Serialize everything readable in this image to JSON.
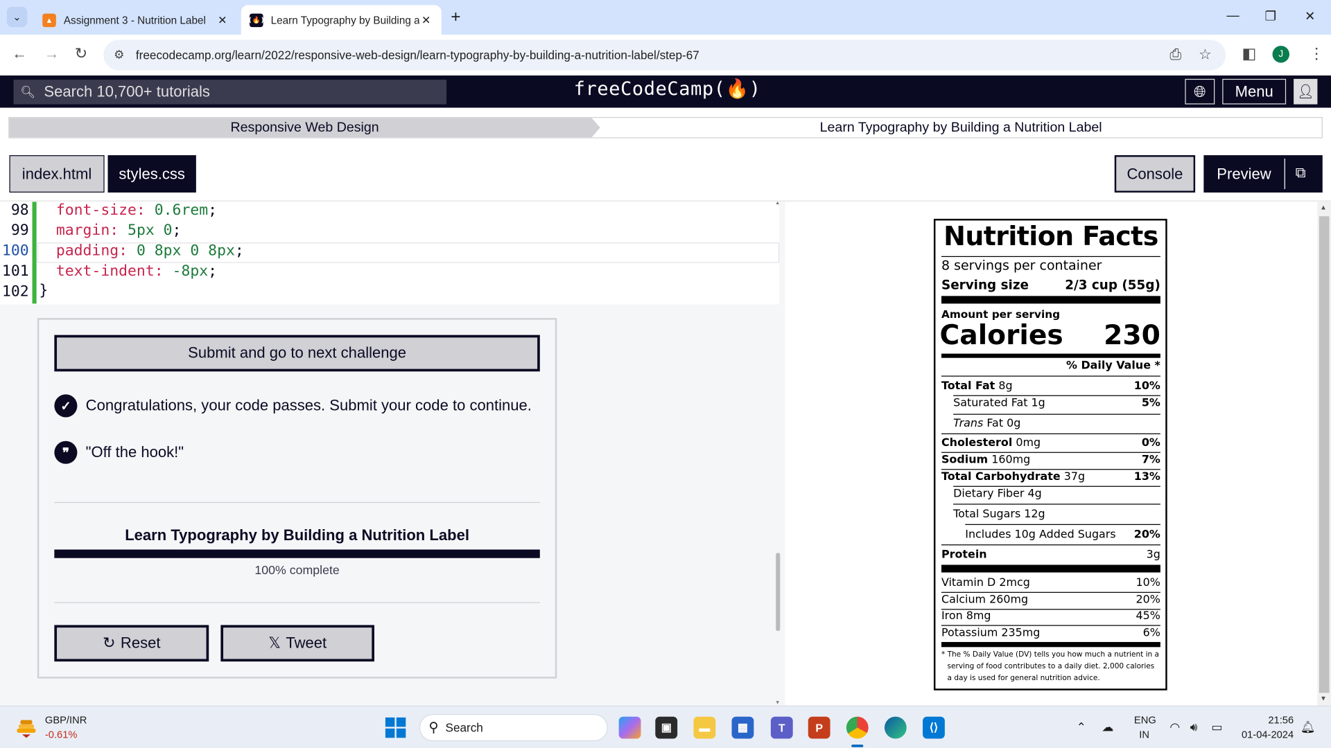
{
  "browser": {
    "tabs": [
      {
        "title": "Assignment 3 - Nutrition Label",
        "active": false
      },
      {
        "title": "Learn Typography by Building a Nutrition Label",
        "active": true
      }
    ],
    "url": "freecodecamp.org/learn/2022/responsive-web-design/learn-typography-by-building-a-nutrition-label/step-67",
    "profile_initial": "J"
  },
  "fcc_nav": {
    "search_placeholder": "Search 10,700+ tutorials",
    "logo": "freeCodeCamp(🔥)",
    "menu_label": "Menu"
  },
  "breadcrumb": {
    "superblock": "Responsive Web Design",
    "block": "Learn Typography by Building a Nutrition Label"
  },
  "editor_tabs": {
    "html": "index.html",
    "css": "styles.css",
    "console": "Console",
    "preview": "Preview"
  },
  "code_lines": [
    {
      "num": "98",
      "prop": "font-size",
      "val": "0.6rem"
    },
    {
      "num": "99",
      "prop": "margin",
      "val": "5px 0"
    },
    {
      "num": "100",
      "prop": "padding",
      "val": "0 8px 0 8px"
    },
    {
      "num": "101",
      "prop": "text-indent",
      "val": "-8px"
    },
    {
      "num": "102",
      "brace": "}"
    }
  ],
  "challenge": {
    "submit_label": "Submit and go to next challenge",
    "pass_message": "Congratulations, your code passes. Submit your code to continue.",
    "quote": "\"Off the hook!\"",
    "course_title": "Learn Typography by Building a Nutrition Label",
    "progress_fraction": 1.0,
    "progress_text": "100% complete",
    "reset_label": "Reset",
    "tweet_label": "Tweet"
  },
  "nutrition": {
    "title": "Nutrition Facts",
    "servings": "8 servings per container",
    "serving_size_label": "Serving size",
    "serving_size_value": "2/3 cup (55g)",
    "amount_per_serving": "Amount per serving",
    "calories_label": "Calories",
    "calories_value": "230",
    "daily_value_header": "% Daily Value *",
    "rows": [
      {
        "name": "Total Fat",
        "amount": "8g",
        "pct": "10%"
      },
      {
        "name": "Saturated Fat 1g",
        "pct": "5%"
      },
      {
        "trans": "Trans",
        "name": "Fat 0g"
      },
      {
        "name": "Cholesterol",
        "amount": "0mg",
        "pct": "0%"
      },
      {
        "name": "Sodium",
        "amount": "160mg",
        "pct": "7%"
      },
      {
        "name": "Total Carbohydrate",
        "amount": "37g",
        "pct": "13%"
      },
      {
        "name": "Dietary Fiber 4g"
      },
      {
        "name": "Total Sugars 12g"
      },
      {
        "name": "Includes 10g Added Sugars",
        "pct": "20%"
      },
      {
        "name": "Protein",
        "pct": "3g"
      }
    ],
    "vitamins": [
      {
        "name": "Vitamin D 2mcg",
        "pct": "10%"
      },
      {
        "name": "Calcium 260mg",
        "pct": "20%"
      },
      {
        "name": "Iron 8mg",
        "pct": "45%"
      },
      {
        "name": "Potassium 235mg",
        "pct": "6%"
      }
    ],
    "footnote": "* The % Daily Value (DV) tells you how much a nutrient in a serving of food contributes to a daily diet. 2,000 calories a day is used for general nutrition advice."
  },
  "taskbar": {
    "ticker": "GBP/INR",
    "ticker_change": "-0.61%",
    "search": "Search",
    "lang1": "ENG",
    "lang2": "IN",
    "time": "21:56",
    "date": "01-04-2024"
  },
  "colors": {
    "fcc_dark": "#0a0a23",
    "fcc_gray": "#d0d0d5",
    "css_property": "#c7254e",
    "css_value": "#1c7a3b",
    "gutter_pass": "#3eb33e"
  }
}
